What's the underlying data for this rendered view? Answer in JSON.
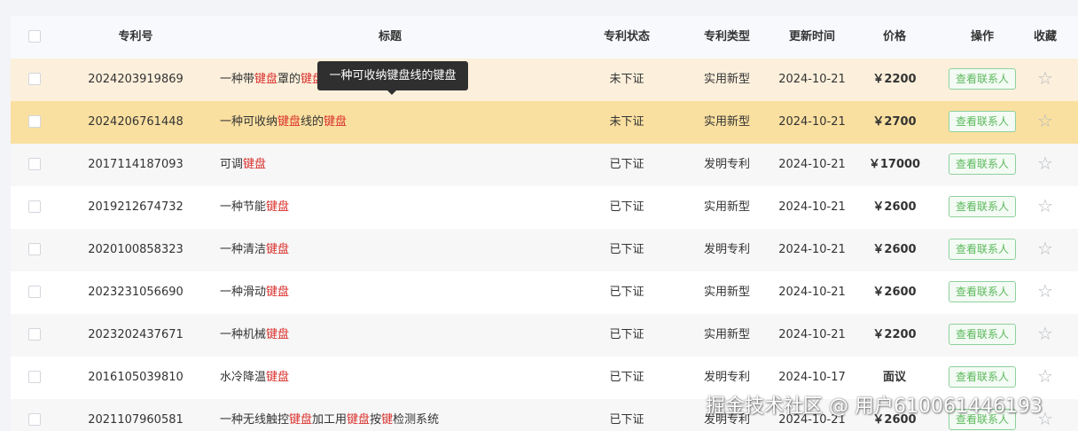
{
  "columns": {
    "patent_no": "专利号",
    "title": "标题",
    "status": "专利状态",
    "type": "专利类型",
    "updated": "更新时间",
    "price": "价格",
    "action": "操作",
    "favorite": "收藏"
  },
  "rows": [
    {
      "patent_no": "2024203919869",
      "title": "一种带键盘罩的键盘",
      "title_parts": [
        {
          "t": "一种带",
          "kw": false
        },
        {
          "t": "键盘",
          "kw": true
        },
        {
          "t": "罩的",
          "kw": false
        },
        {
          "t": "键盘",
          "kw": true
        }
      ],
      "status": "未下证",
      "type": "实用新型",
      "updated": "2024-10-21",
      "price": "￥2200",
      "action": "查看联系人"
    },
    {
      "patent_no": "2024206761448",
      "title": "一种可收纳键盘线的键盘",
      "title_parts": [
        {
          "t": "一种可收纳",
          "kw": false
        },
        {
          "t": "键盘",
          "kw": true
        },
        {
          "t": "线的",
          "kw": false
        },
        {
          "t": "键盘",
          "kw": true
        }
      ],
      "status": "未下证",
      "type": "实用新型",
      "updated": "2024-10-21",
      "price": "￥2700",
      "action": "查看联系人"
    },
    {
      "patent_no": "2017114187093",
      "title": "可调键盘",
      "title_parts": [
        {
          "t": "可调",
          "kw": false
        },
        {
          "t": "键盘",
          "kw": true
        }
      ],
      "status": "已下证",
      "type": "发明专利",
      "updated": "2024-10-21",
      "price": "￥17000",
      "action": "查看联系人"
    },
    {
      "patent_no": "2019212674732",
      "title": "一种节能键盘",
      "title_parts": [
        {
          "t": "一种节能",
          "kw": false
        },
        {
          "t": "键盘",
          "kw": true
        }
      ],
      "status": "已下证",
      "type": "实用新型",
      "updated": "2024-10-21",
      "price": "￥2600",
      "action": "查看联系人"
    },
    {
      "patent_no": "2020100858323",
      "title": "一种清洁键盘",
      "title_parts": [
        {
          "t": "一种清洁",
          "kw": false
        },
        {
          "t": "键盘",
          "kw": true
        }
      ],
      "status": "已下证",
      "type": "发明专利",
      "updated": "2024-10-21",
      "price": "￥2600",
      "action": "查看联系人"
    },
    {
      "patent_no": "2023231056690",
      "title": "一种滑动键盘",
      "title_parts": [
        {
          "t": "一种滑动",
          "kw": false
        },
        {
          "t": "键盘",
          "kw": true
        }
      ],
      "status": "已下证",
      "type": "实用新型",
      "updated": "2024-10-21",
      "price": "￥2600",
      "action": "查看联系人"
    },
    {
      "patent_no": "2023202437671",
      "title": "一种机械键盘",
      "title_parts": [
        {
          "t": "一种机械",
          "kw": false
        },
        {
          "t": "键盘",
          "kw": true
        }
      ],
      "status": "已下证",
      "type": "实用新型",
      "updated": "2024-10-21",
      "price": "￥2200",
      "action": "查看联系人"
    },
    {
      "patent_no": "2016105039810",
      "title": "水冷降温键盘",
      "title_parts": [
        {
          "t": "水冷降温",
          "kw": false
        },
        {
          "t": "键盘",
          "kw": true
        }
      ],
      "status": "已下证",
      "type": "发明专利",
      "updated": "2024-10-17",
      "price": "面议",
      "action": "查看联系人"
    },
    {
      "patent_no": "2021107960581",
      "title": "一种无线触控键盘加工用键盘按键检测系统",
      "title_parts": [
        {
          "t": "一种无线触控",
          "kw": false
        },
        {
          "t": "键盘",
          "kw": true
        },
        {
          "t": "加工用",
          "kw": false
        },
        {
          "t": "键盘",
          "kw": true
        },
        {
          "t": "按",
          "kw": false
        },
        {
          "t": "键",
          "kw": true
        },
        {
          "t": "检测系统",
          "kw": false
        }
      ],
      "status": "已下证",
      "type": "发明专利",
      "updated": "2024-10-21",
      "price": "￥2600",
      "action": "查看联系人"
    }
  ],
  "tooltip": "一种可收纳键盘线的键盘",
  "watermark": "掘金技术社区 @ 用户610061446193",
  "colors": {
    "highlight_row_1": "#fcf0dc",
    "highlight_row_2": "#fae0a0",
    "stripe": "#f7f7f7",
    "keyword": "#d9302c",
    "price": "#e0201b",
    "contact_border": "#8fd19e",
    "contact_text": "#5cb85c"
  },
  "icons": {
    "favorite": "star-outline-icon"
  }
}
